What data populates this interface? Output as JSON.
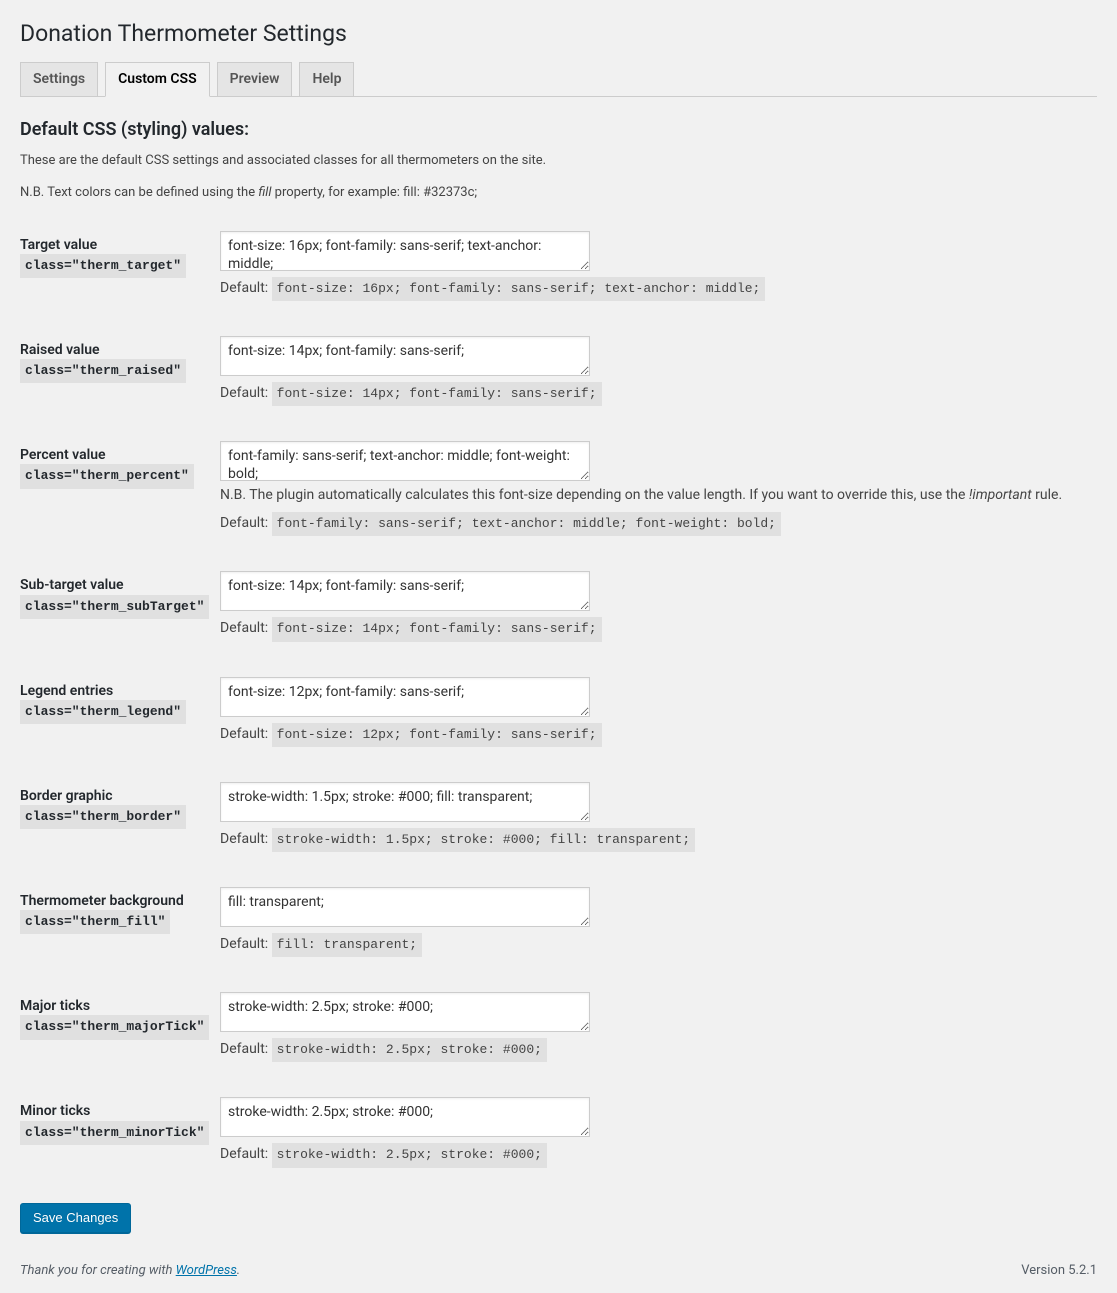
{
  "page_title": "Donation Thermometer Settings",
  "tabs": {
    "settings": "Settings",
    "custom_css": "Custom CSS",
    "preview": "Preview",
    "help": "Help"
  },
  "section_title": "Default CSS (styling) values:",
  "intro1": "These are the default CSS settings and associated classes for all thermometers on the site.",
  "intro2_pre": "N.B. Text colors can be defined using the ",
  "intro2_em": "fill",
  "intro2_post": " property, for example: fill: #32373c;",
  "fields": {
    "target": {
      "label": "Target value",
      "class": "class=\"therm_target\"",
      "value": "font-size: 16px; font-family: sans-serif; text-anchor: middle;",
      "default": "font-size: 16px; font-family: sans-serif; text-anchor: middle;"
    },
    "raised": {
      "label": "Raised value",
      "class": "class=\"therm_raised\"",
      "value": "font-size: 14px; font-family: sans-serif;",
      "default": "font-size: 14px; font-family: sans-serif;"
    },
    "percent": {
      "label": "Percent value",
      "class": "class=\"therm_percent\"",
      "value": "font-family: sans-serif; text-anchor: middle; font-weight: bold;",
      "nb_pre": "N.B. The plugin automatically calculates this font-size depending on the value length. If you want to override this, use the ",
      "nb_em": "!important",
      "nb_post": " rule.",
      "default": "font-family: sans-serif; text-anchor: middle; font-weight: bold;"
    },
    "subtarget": {
      "label": "Sub-target value",
      "class": "class=\"therm_subTarget\"",
      "value": "font-size: 14px; font-family: sans-serif;",
      "default": "font-size: 14px; font-family: sans-serif;"
    },
    "legend": {
      "label": "Legend entries",
      "class": "class=\"therm_legend\"",
      "value": "font-size: 12px; font-family: sans-serif;",
      "default": "font-size: 12px; font-family: sans-serif;"
    },
    "border": {
      "label": "Border graphic",
      "class": "class=\"therm_border\"",
      "value": "stroke-width: 1.5px; stroke: #000; fill: transparent;",
      "default": "stroke-width: 1.5px; stroke: #000; fill: transparent;"
    },
    "fill": {
      "label": "Thermometer background",
      "class": "class=\"therm_fill\"",
      "value": "fill: transparent;",
      "default": "fill: transparent;"
    },
    "major": {
      "label": "Major ticks",
      "class": "class=\"therm_majorTick\"",
      "value": "stroke-width: 2.5px; stroke: #000;",
      "default": "stroke-width: 2.5px; stroke: #000;"
    },
    "minor": {
      "label": "Minor ticks",
      "class": "class=\"therm_minorTick\"",
      "value": "stroke-width: 2.5px; stroke: #000;",
      "default": "stroke-width: 2.5px; stroke: #000;"
    }
  },
  "labels": {
    "default_prefix": "Default: "
  },
  "save_button": "Save Changes",
  "footer": {
    "thanks_pre": "Thank you for creating with ",
    "link_text": "WordPress",
    "thanks_post": ".",
    "version": "Version 5.2.1"
  }
}
